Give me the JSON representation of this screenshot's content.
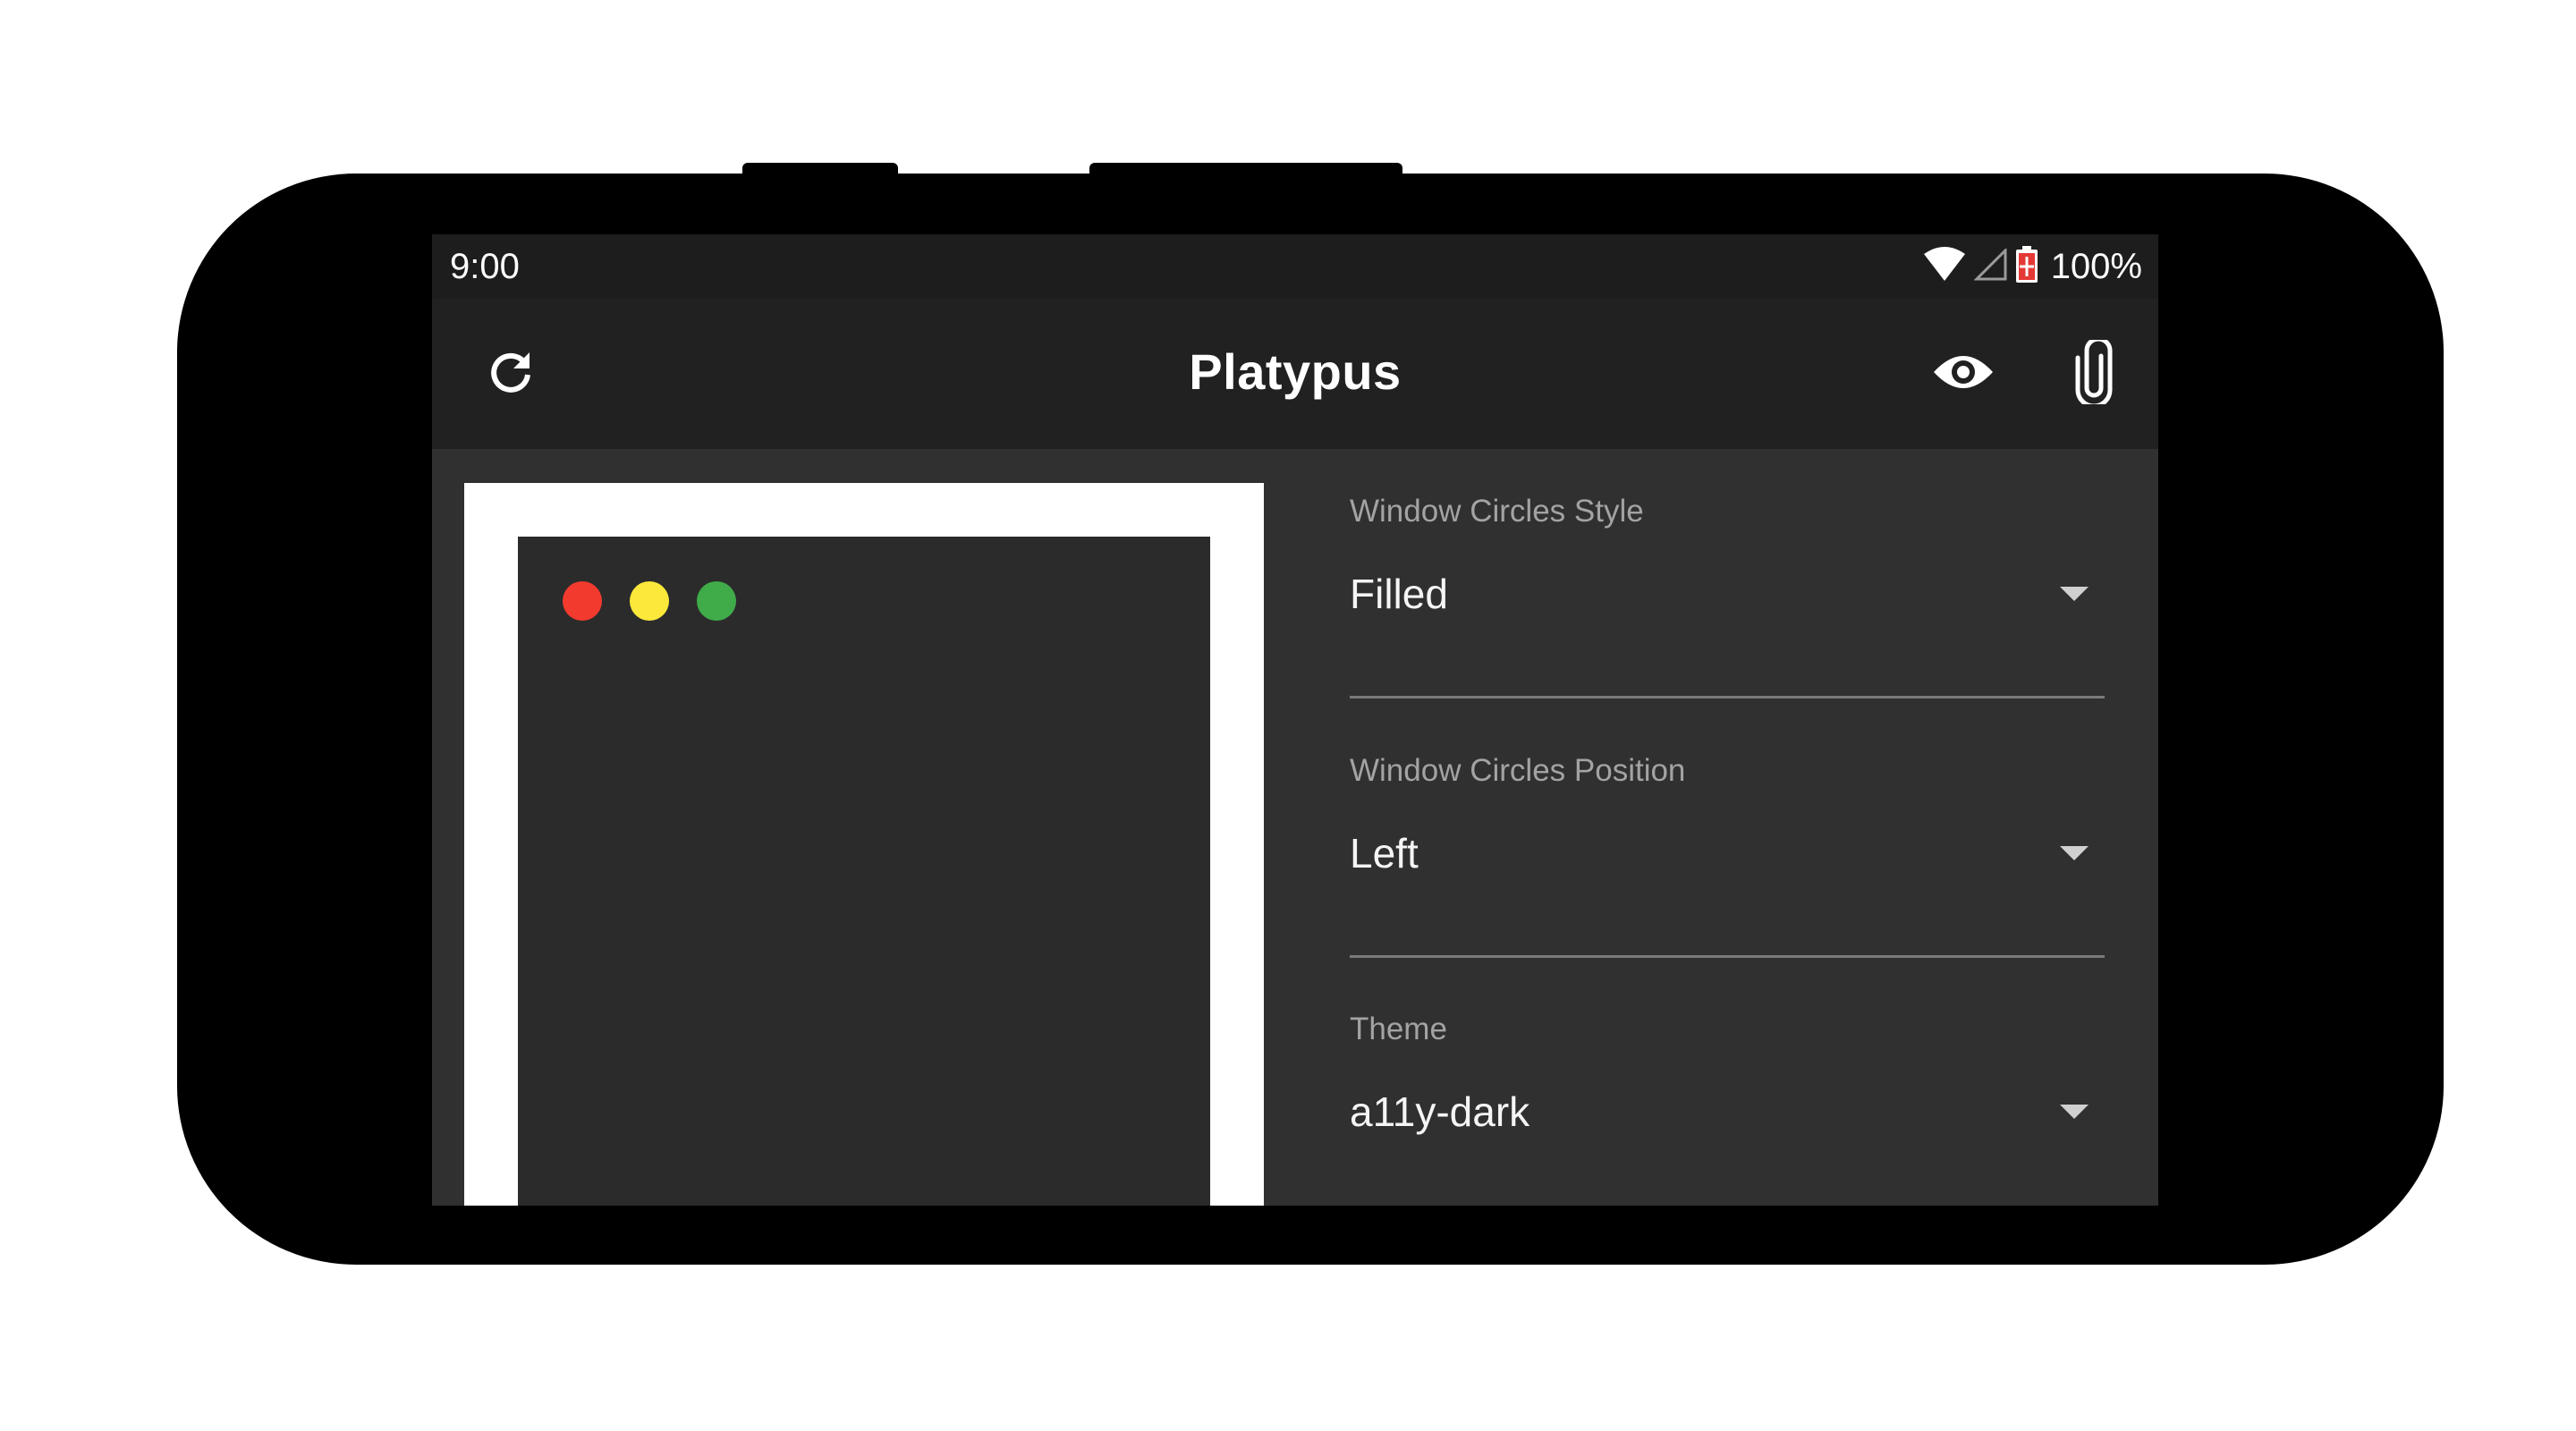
{
  "status_bar": {
    "time": "9:00",
    "battery_percent": "100%",
    "icons": [
      "wifi-icon",
      "cellular-signal-icon",
      "battery-charging-icon"
    ]
  },
  "app_bar": {
    "title": "Platypus",
    "left_action": "refresh-icon",
    "right_actions": [
      "eye-icon",
      "paperclip-icon"
    ]
  },
  "preview": {
    "window_circles": [
      {
        "name": "close",
        "color": "#f33a2f"
      },
      {
        "name": "minimize",
        "color": "#fbe83a"
      },
      {
        "name": "maximize",
        "color": "#3fac49"
      }
    ],
    "frame_color": "#ffffff",
    "window_color": "#2b2b2b"
  },
  "settings": [
    {
      "label": "Window Circles Style",
      "value": "Filled"
    },
    {
      "label": "Window Circles Position",
      "value": "Left"
    },
    {
      "label": "Theme",
      "value": "a11y-dark"
    }
  ],
  "colors": {
    "screen_background": "#303030",
    "app_bar": "#212121",
    "status_bar": "#1d1d1d"
  }
}
